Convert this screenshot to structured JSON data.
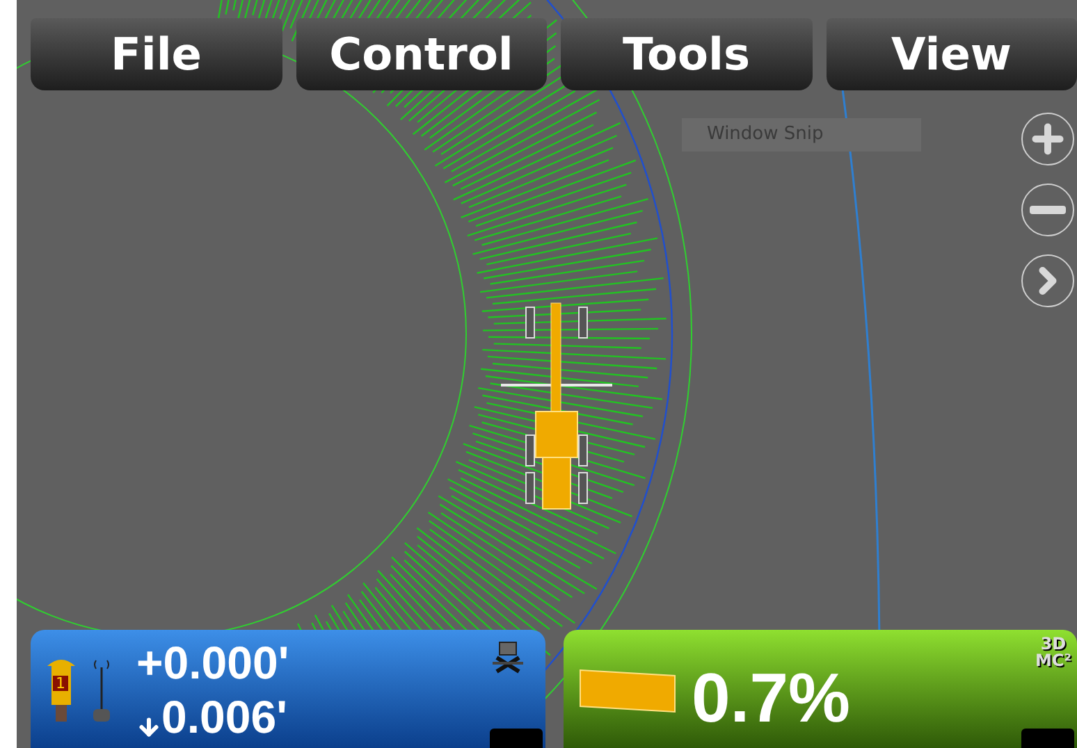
{
  "menu": [
    {
      "label": "File"
    },
    {
      "label": "Control"
    },
    {
      "label": "Tools"
    },
    {
      "label": "View"
    }
  ],
  "overlay_label": "Window Snip",
  "elevation_panel": {
    "receiver_number": "1",
    "offset": "+0.000'",
    "cut_fill": "0.006'"
  },
  "slope_panel": {
    "slope": "0.7%",
    "logo": [
      "3D",
      "MC²"
    ]
  }
}
